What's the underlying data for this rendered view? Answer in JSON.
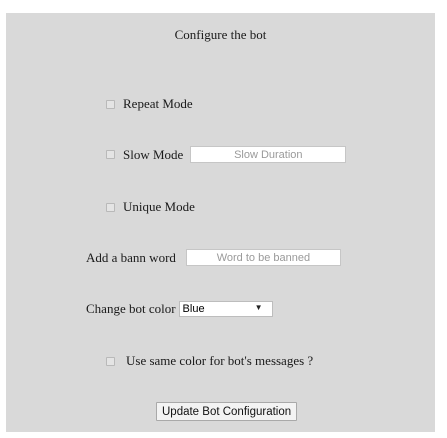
{
  "config": {
    "title": "Configure the bot",
    "repeat_mode": {
      "label": "Repeat Mode",
      "checked": false
    },
    "slow_mode": {
      "label": "Slow Mode",
      "checked": false,
      "input_value": "",
      "input_placeholder": "Slow Duration"
    },
    "unique_mode": {
      "label": "Unique Mode",
      "checked": false
    },
    "bann_word": {
      "label": "Add a bann word",
      "input_value": "",
      "input_placeholder": "Word to be banned"
    },
    "bot_color": {
      "label": "Change bot color",
      "selected": "Blue",
      "arrow": "▼"
    },
    "same_color": {
      "label": "Use same color for bot's messages ?",
      "checked": false
    },
    "update_button": "Update Bot Configuration"
  }
}
